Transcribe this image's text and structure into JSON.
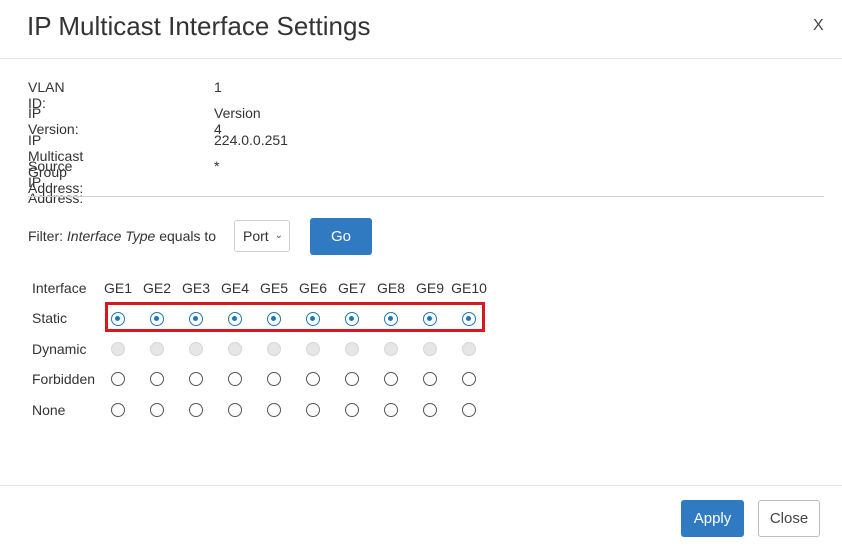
{
  "dialog": {
    "title": "IP Multicast Interface Settings",
    "close_glyph": "X"
  },
  "info": [
    {
      "label": "VLAN ID:",
      "value": "1"
    },
    {
      "label": "IP Version:",
      "value": "Version 4"
    },
    {
      "label": "IP Multicast Group Address:",
      "value": "224.0.0.251"
    },
    {
      "label": "Source IP Address:",
      "value": "*"
    }
  ],
  "filter": {
    "label": "Filter:",
    "field": "Interface Type",
    "operator": "equals to",
    "selected": "Port",
    "go_label": "Go"
  },
  "grid": {
    "header_label": "Interface",
    "interfaces": [
      "GE1",
      "GE2",
      "GE3",
      "GE4",
      "GE5",
      "GE6",
      "GE7",
      "GE8",
      "GE9",
      "GE10"
    ],
    "rows": [
      {
        "label": "Static",
        "state": "checked"
      },
      {
        "label": "Dynamic",
        "state": "disabled"
      },
      {
        "label": "Forbidden",
        "state": "unchecked"
      },
      {
        "label": "None",
        "state": "unchecked"
      }
    ]
  },
  "footer": {
    "apply_label": "Apply",
    "close_label": "Close"
  },
  "colors": {
    "primary_button": "#2f7ac1",
    "radio_checked": "#1f78b4",
    "highlight_box": "#d7191f"
  }
}
